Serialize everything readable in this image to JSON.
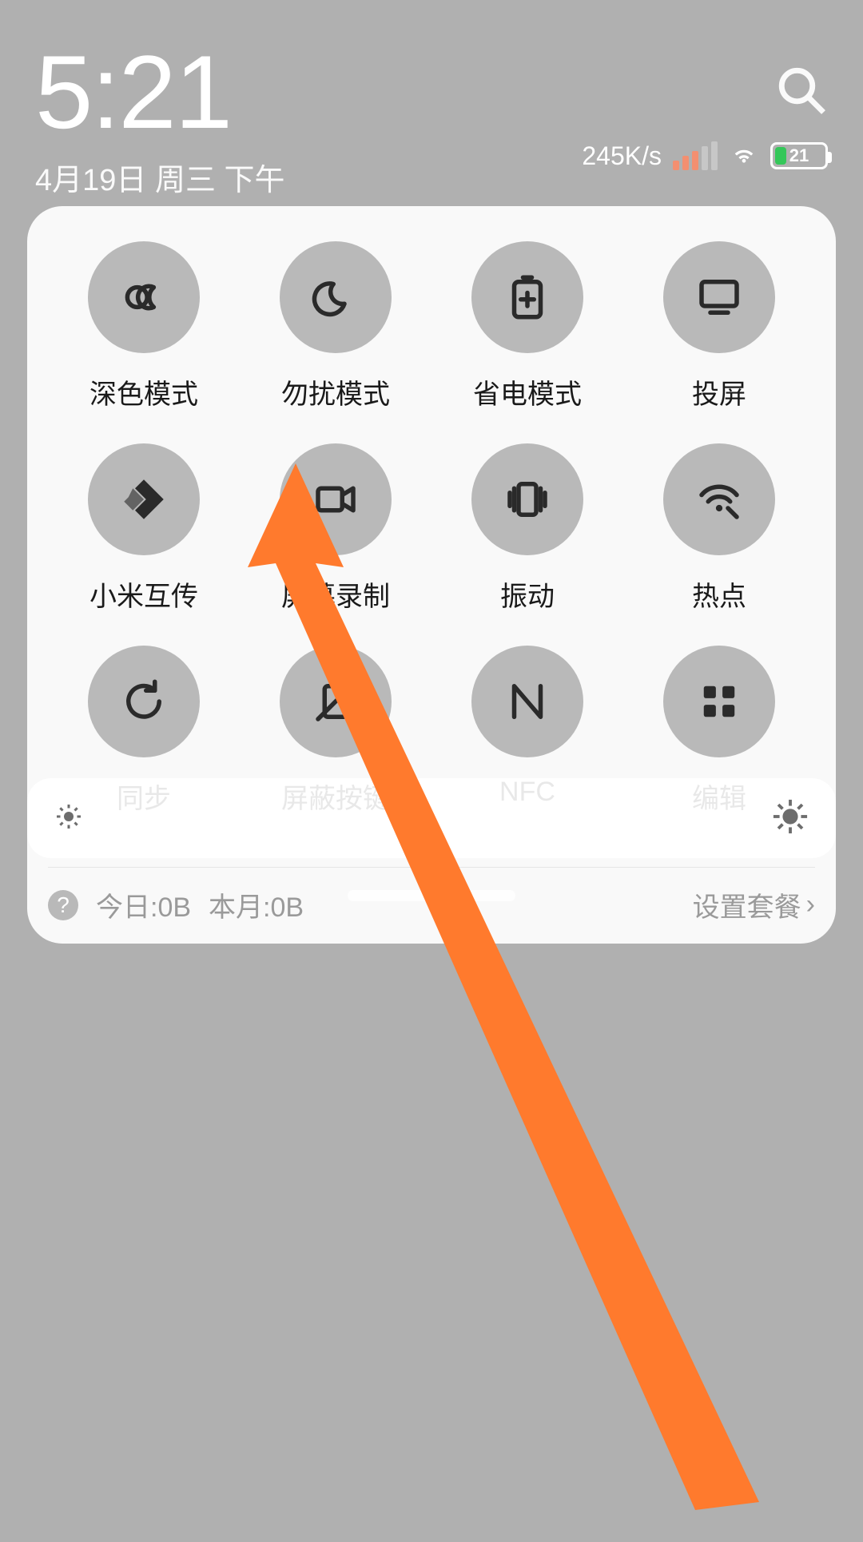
{
  "header": {
    "time": "5:21",
    "date": "4月19日 周三 下午",
    "net_speed": "245K/s",
    "battery_level": "21"
  },
  "tiles": [
    {
      "id": "dark-mode",
      "label": "深色模式",
      "icon": "dark-mode-icon"
    },
    {
      "id": "dnd",
      "label": "勿扰模式",
      "icon": "moon-icon"
    },
    {
      "id": "battery-saver",
      "label": "省电模式",
      "icon": "battery-plus-icon"
    },
    {
      "id": "cast",
      "label": "投屏",
      "icon": "cast-icon"
    },
    {
      "id": "mi-share",
      "label": "小米互传",
      "icon": "mi-share-icon"
    },
    {
      "id": "screen-record",
      "label": "屏幕录制",
      "icon": "video-icon"
    },
    {
      "id": "vibrate",
      "label": "振动",
      "icon": "vibrate-icon"
    },
    {
      "id": "hotspot",
      "label": "热点",
      "icon": "hotspot-icon"
    },
    {
      "id": "sync",
      "label": "同步",
      "icon": "sync-icon"
    },
    {
      "id": "block-keys",
      "label": "屏蔽按键",
      "icon": "block-keys-icon"
    },
    {
      "id": "nfc",
      "label": "NFC",
      "icon": "nfc-icon"
    },
    {
      "id": "edit",
      "label": "编辑",
      "icon": "edit-grid-icon"
    }
  ],
  "footer": {
    "today": "今日:0B",
    "month": "本月:0B",
    "plan": "设置套餐"
  },
  "annotation": {
    "target_tile": "screen-record",
    "color": "#ff7a2d"
  }
}
